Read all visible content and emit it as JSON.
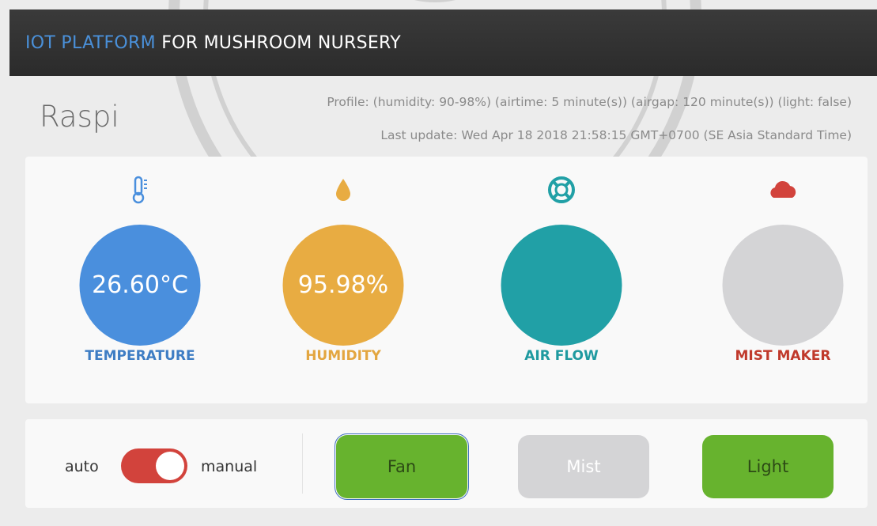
{
  "header": {
    "title_accent": "IOT PLATFORM",
    "title_rest": "FOR MUSHROOM NURSERY"
  },
  "device": {
    "name": "Raspi",
    "profile": "Profile: (humidity: 90-98%) (airtime: 5 minute(s)) (airgap: 120 minute(s)) (light: false)",
    "last_update": "Last update: Wed Apr 18 2018 21:58:15 GMT+0700 (SE Asia Standard Time)"
  },
  "sensors": [
    {
      "key": "temperature",
      "label": "TEMPERATURE",
      "value": "26.60°C",
      "color": "#4a8fdd",
      "label_color": "#3e7dc4",
      "icon": "thermometer-icon"
    },
    {
      "key": "humidity",
      "label": "HUMIDITY",
      "value": "95.98%",
      "color": "#e8ac42",
      "label_color": "#e3a640",
      "icon": "water-drop-icon"
    },
    {
      "key": "airflow",
      "label": "AIR FLOW",
      "value": "",
      "color": "#21a0a6",
      "label_color": "#1f9aa0",
      "icon": "life-ring-icon"
    },
    {
      "key": "mist",
      "label": "MIST MAKER",
      "value": "",
      "color": "#d4d4d6",
      "label_color": "#c0392b",
      "icon": "cloud-icon"
    }
  ],
  "controls": {
    "mode_left": "auto",
    "mode_right": "manual",
    "mode_state": "manual",
    "buttons": [
      {
        "label": "Fan",
        "state": "on",
        "bg": "#67b32e",
        "text_color": "#2c4a15"
      },
      {
        "label": "Mist",
        "state": "off",
        "bg": "#d4d4d6",
        "text_color": "#ffffff"
      },
      {
        "label": "Light",
        "state": "on",
        "bg": "#67b32e",
        "text_color": "#2c4a15"
      }
    ]
  }
}
